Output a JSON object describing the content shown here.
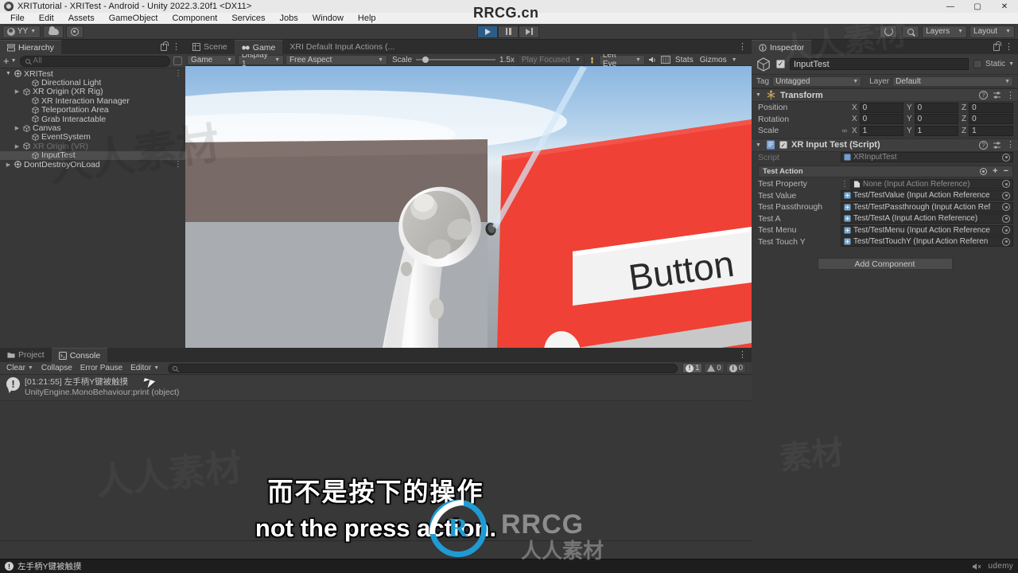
{
  "titlebar": {
    "title": "XRITutorial - XRITest - Android - Unity 2022.3.20f1 <DX11>",
    "minimize": "—",
    "maximize": "▢",
    "close": "✕",
    "icon": "unity-logo-icon"
  },
  "menubar": {
    "items": [
      "File",
      "Edit",
      "Assets",
      "GameObject",
      "Component",
      "Services",
      "Jobs",
      "Window",
      "Help"
    ]
  },
  "toolbar": {
    "account_label": "YY",
    "cloud_icon": "cloud-icon",
    "settings_icon": "gear-icon",
    "play_icon": "play-icon",
    "pause_icon": "pause-icon",
    "step_icon": "step-icon",
    "undo_history_icon": "undo-history-icon",
    "search_icon": "search-icon",
    "layers_label": "Layers",
    "layout_label": "Layout"
  },
  "hierarchy": {
    "tab_label": "Hierarchy",
    "add_label": "+",
    "search_placeholder": "All",
    "items": [
      {
        "label": "XRITest",
        "depth": 0,
        "arrow": "down",
        "icon": "scene-icon",
        "kebab": true,
        "state": "normal"
      },
      {
        "label": "Directional Light",
        "depth": 2,
        "arrow": "none",
        "icon": "gameobject-icon",
        "kebab": false,
        "state": "normal"
      },
      {
        "label": "XR Origin (XR Rig)",
        "depth": 1,
        "arrow": "right",
        "icon": "gameobject-icon",
        "kebab": false,
        "state": "normal"
      },
      {
        "label": "XR Interaction Manager",
        "depth": 2,
        "arrow": "none",
        "icon": "gameobject-icon",
        "kebab": false,
        "state": "normal"
      },
      {
        "label": "Teleportation Area",
        "depth": 2,
        "arrow": "none",
        "icon": "gameobject-icon",
        "kebab": false,
        "state": "normal"
      },
      {
        "label": "Grab Interactable",
        "depth": 2,
        "arrow": "none",
        "icon": "gameobject-icon",
        "kebab": false,
        "state": "normal"
      },
      {
        "label": "Canvas",
        "depth": 1,
        "arrow": "right",
        "icon": "gameobject-icon",
        "kebab": false,
        "state": "normal"
      },
      {
        "label": "EventSystem",
        "depth": 2,
        "arrow": "none",
        "icon": "gameobject-icon",
        "kebab": false,
        "state": "normal"
      },
      {
        "label": "XR Origin (VR)",
        "depth": 1,
        "arrow": "right",
        "icon": "gameobject-icon",
        "kebab": false,
        "state": "dimmed"
      },
      {
        "label": "InputTest",
        "depth": 2,
        "arrow": "none",
        "icon": "gameobject-icon",
        "kebab": false,
        "state": "selected"
      },
      {
        "label": "DontDestroyOnLoad",
        "depth": 0,
        "arrow": "right",
        "icon": "scene-icon",
        "kebab": true,
        "state": "normal"
      }
    ]
  },
  "gameview": {
    "tabs": [
      {
        "label": "Scene",
        "icon": "scene-tab-icon",
        "active": false
      },
      {
        "label": "Game",
        "icon": "game-tab-icon",
        "active": true
      },
      {
        "label": "XRI Default Input Actions (...",
        "icon": "none",
        "active": false
      }
    ],
    "display_target": "Game",
    "display": "Display 1",
    "aspect": "Free Aspect",
    "scale_label": "Scale",
    "scale_value": "1.5x",
    "play_focus": "Play Focused",
    "eye": "Left Eye",
    "mute_icon": "mute-audio-icon",
    "frame_icon": "frame-debugger-icon",
    "stats_label": "Stats",
    "gizmos_label": "Gizmos",
    "scene_description": "VR game view: white VR controller pointing a blue ray at a red UI canvas panel with a Button label and a slider, over a grey ground and blue sky horizon.",
    "canvas_button_label": "Button",
    "colors": {
      "panel_red": "#ef4136",
      "sky_blue": "#9dc4e8",
      "ground_grey": "#a8abb0",
      "wall_brown": "#786a66",
      "ray_blue": "#bcd9f2"
    }
  },
  "inspector": {
    "tab_label": "Inspector",
    "object_name": "InputTest",
    "enabled": true,
    "static_label": "Static",
    "tag_label": "Tag",
    "tag_value": "Untagged",
    "layer_label": "Layer",
    "layer_value": "Default",
    "transform": {
      "title": "Transform",
      "rows": [
        {
          "label": "Position",
          "x": "0",
          "y": "0",
          "z": "0",
          "linked": false
        },
        {
          "label": "Rotation",
          "x": "0",
          "y": "0",
          "z": "0",
          "linked": false
        },
        {
          "label": "Scale",
          "x": "1",
          "y": "1",
          "z": "1",
          "linked": true
        }
      ],
      "axis_labels": [
        "X",
        "Y",
        "Z"
      ]
    },
    "script_component": {
      "title": "XR Input Test (Script)",
      "enabled": true,
      "script_label": "Script",
      "script_value": "XRInputTest",
      "section_label": "Test Action",
      "section_icons": [
        "gear-icon",
        "plus-icon",
        "minus-icon"
      ],
      "fields": [
        {
          "label": "Test Property",
          "value": "None (Input Action Reference)",
          "empty": true,
          "kebab": true
        },
        {
          "label": "Test Value",
          "value": "Test/TestValue (Input Action Reference",
          "empty": false,
          "kebab": false
        },
        {
          "label": "Test Passthrough",
          "value": "Test/TestPassthrough (Input Action Ref",
          "empty": false,
          "kebab": false
        },
        {
          "label": "Test A",
          "value": "Test/TestA (Input Action Reference)",
          "empty": false,
          "kebab": false
        },
        {
          "label": "Test Menu",
          "value": "Test/TestMenu (Input Action Reference",
          "empty": false,
          "kebab": false
        },
        {
          "label": "Test Touch Y",
          "value": "Test/TestTouchY (Input Action Referen",
          "empty": false,
          "kebab": false
        }
      ]
    },
    "add_component_label": "Add Component"
  },
  "console": {
    "tabs": [
      {
        "label": "Project",
        "icon": "folder-icon",
        "active": false
      },
      {
        "label": "Console",
        "icon": "console-icon",
        "active": true
      }
    ],
    "clear_label": "Clear",
    "collapse_label": "Collapse",
    "error_pause_label": "Error Pause",
    "editor_label": "Editor",
    "search_placeholder": "",
    "counts": {
      "error": "1",
      "warning": "0",
      "info": "0"
    },
    "log_entries": [
      {
        "line1": "[01:21:55] 左手柄Y键被触摸",
        "line2": "UnityEngine.MonoBehaviour:print (object)",
        "type": "error"
      }
    ]
  },
  "statusbar": {
    "message": "左手柄Y键被触摸",
    "brand": "udemy"
  },
  "overlay": {
    "subtitle_cn": "而不是按下的操作",
    "subtitle_en": "not the press action.",
    "watermark_top": "RRCG.cn",
    "watermark_center": "RRCG",
    "watermark_cn": "人人素材"
  }
}
